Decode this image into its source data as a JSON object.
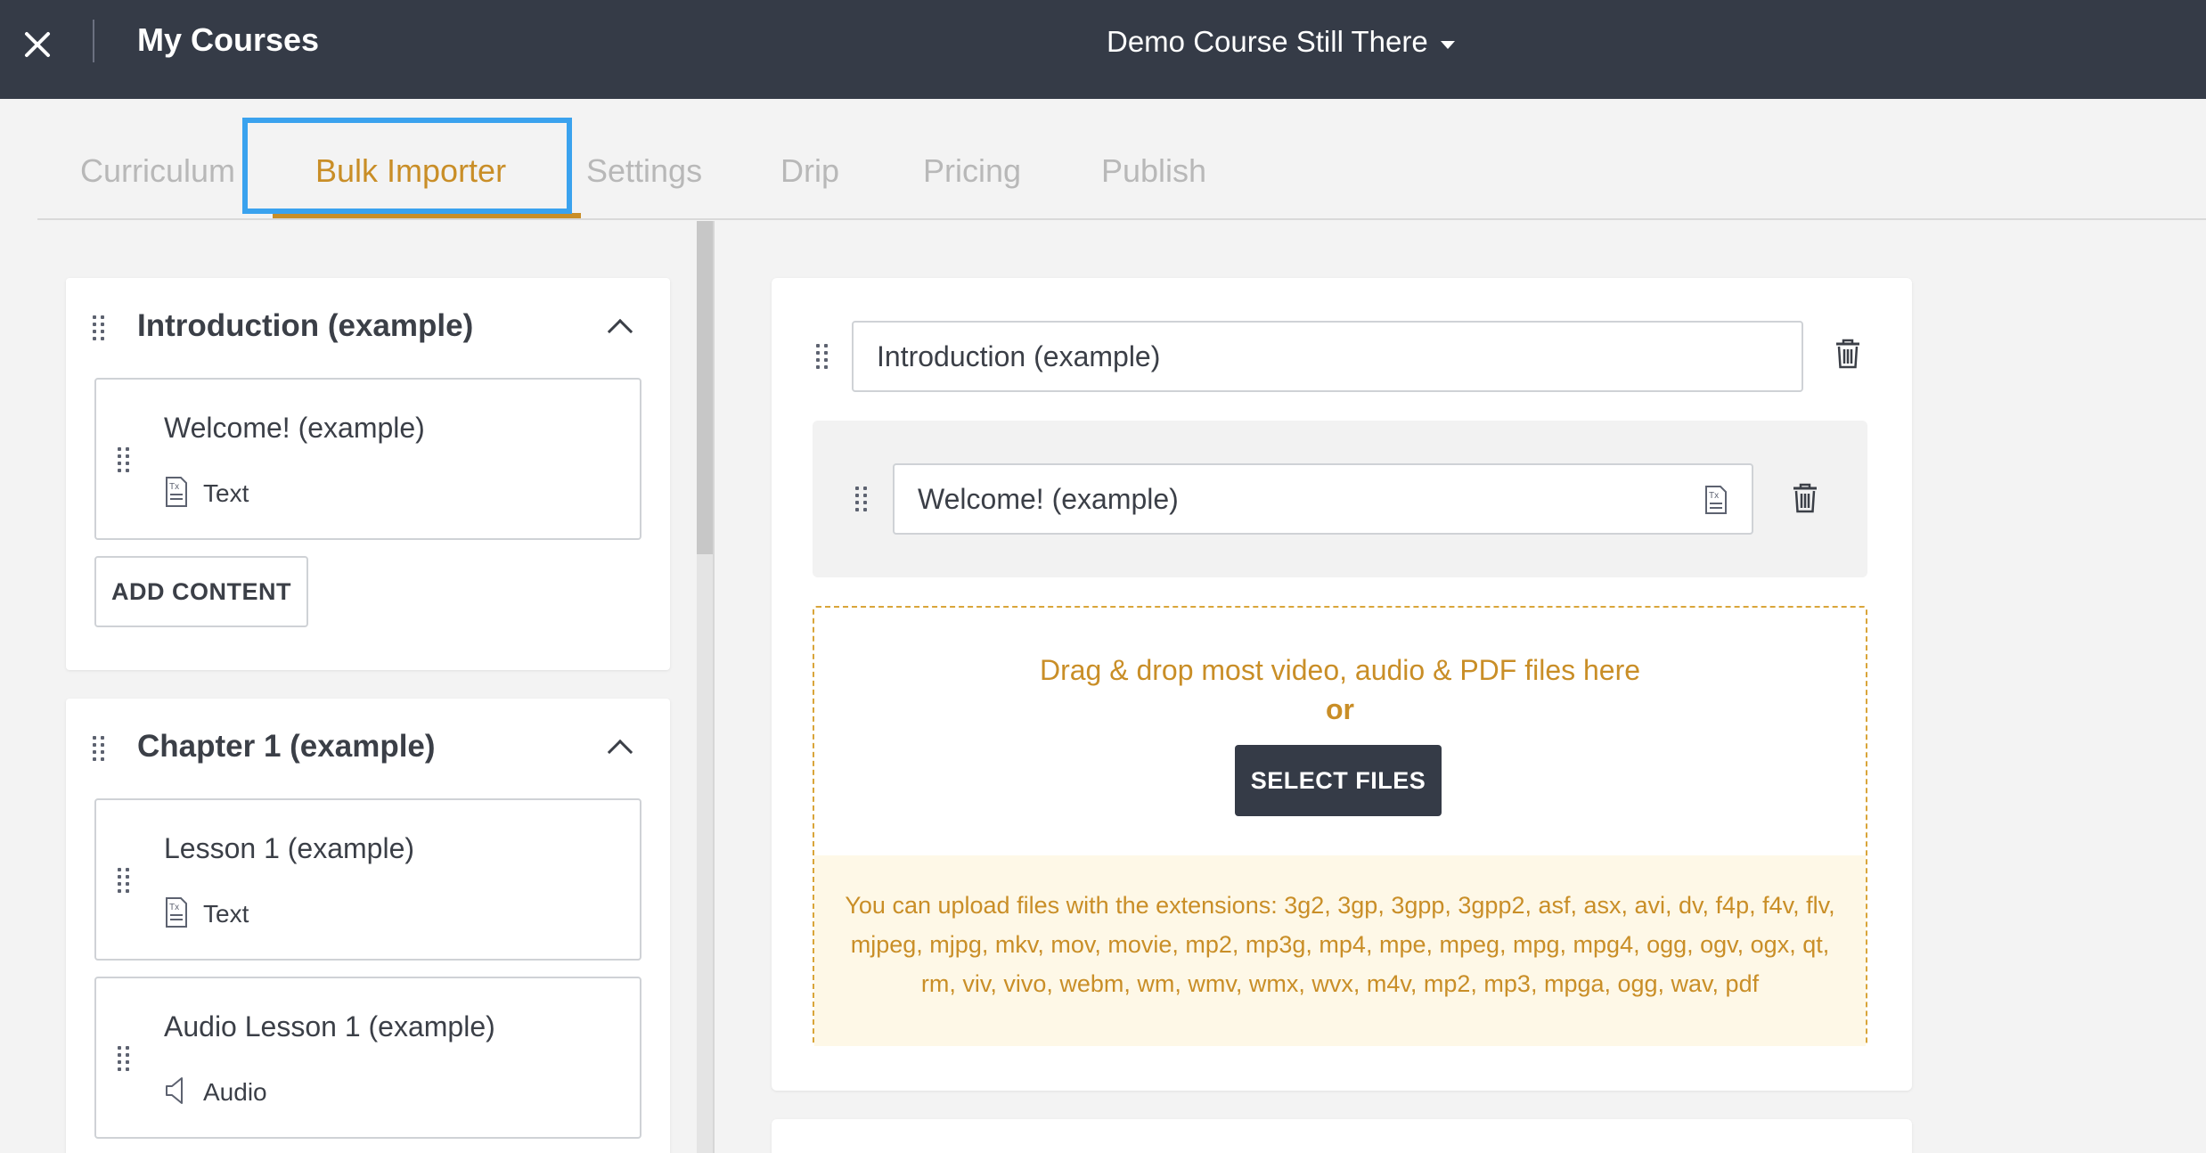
{
  "topbar": {
    "title": "My Courses",
    "course_name": "Demo Course Still There"
  },
  "tabs": [
    {
      "label": "Curriculum",
      "active": false
    },
    {
      "label": "Bulk Importer",
      "active": true
    },
    {
      "label": "Settings",
      "active": false
    },
    {
      "label": "Drip",
      "active": false
    },
    {
      "label": "Pricing",
      "active": false
    },
    {
      "label": "Publish",
      "active": false
    }
  ],
  "sidebar": {
    "sections": [
      {
        "title": "Introduction (example)",
        "lessons": [
          {
            "title": "Welcome! (example)",
            "type": "Text",
            "icon": "text-doc-icon"
          }
        ],
        "add_content_label": "ADD CONTENT"
      },
      {
        "title": "Chapter 1 (example)",
        "lessons": [
          {
            "title": "Lesson 1 (example)",
            "type": "Text",
            "icon": "text-doc-icon"
          },
          {
            "title": "Audio Lesson 1 (example)",
            "type": "Audio",
            "icon": "speaker-icon"
          }
        ]
      }
    ]
  },
  "editor": {
    "section_title_value": "Introduction (example)",
    "lesson_title_value": "Welcome! (example)",
    "dropzone": {
      "instruction": "Drag & drop most video, audio & PDF files here",
      "or_label": "or",
      "select_files_label": "SELECT FILES",
      "extensions_note": "You can upload files with the extensions: 3g2, 3gp, 3gpp, 3gpp2, asf, asx, avi, dv, f4p, f4v, flv, mjpeg, mjpg, mkv, mov, movie, mp2, mp3g, mp4, mpe, mpeg, mpg, mpg4, ogg, ogv, ogx, qt, rm, viv, vivo, webm, wm, wmv, wmx, wvx, m4v, mp2, mp3, mpga, ogg, wav, pdf"
    }
  },
  "colors": {
    "topbar_bg": "#353b47",
    "accent": "#c98e27",
    "highlight": "#3aa2ee",
    "extensions_bg": "#fef8e7"
  }
}
